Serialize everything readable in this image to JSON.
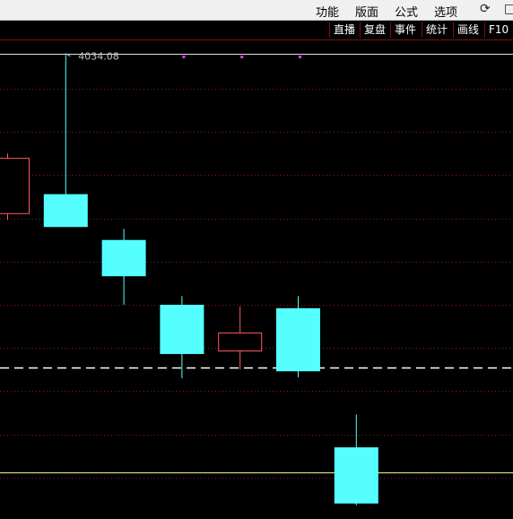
{
  "menu": {
    "items": [
      "功能",
      "版面",
      "公式",
      "选项"
    ],
    "refresh_icon": "refresh-icon",
    "restore_icon": "window-restore-icon"
  },
  "toolbar": {
    "buttons": [
      "直播",
      "复盘",
      "事件",
      "统计",
      "画线",
      "F10"
    ]
  },
  "chart_data": {
    "type": "candlestick",
    "high_label": "4034.08",
    "candles": [
      {
        "open": 4015.5,
        "close": 4022.0,
        "high": 4022.5,
        "low": 4014.8,
        "direction": "up"
      },
      {
        "open": 4017.8,
        "close": 4014.0,
        "high": 4034.08,
        "low": 4014.0,
        "direction": "down"
      },
      {
        "open": 4012.5,
        "close": 4008.3,
        "high": 4013.8,
        "low": 4005.0,
        "direction": "down"
      },
      {
        "open": 4005.0,
        "close": 3999.3,
        "high": 4006.0,
        "low": 3996.5,
        "direction": "down"
      },
      {
        "open": 3999.6,
        "close": 4001.8,
        "high": 4004.8,
        "low": 3997.5,
        "direction": "up"
      },
      {
        "open": 4004.6,
        "close": 3997.3,
        "high": 4006.0,
        "low": 3996.6,
        "direction": "down"
      },
      {
        "open": 3988.5,
        "close": 3982.0,
        "high": 3992.3,
        "low": 3981.8,
        "direction": "down"
      }
    ],
    "y_grid_values": [
      4030,
      4025,
      4020,
      4015,
      4010,
      4005,
      4000,
      3995,
      3990,
      3985,
      3980,
      3975
    ],
    "reference_lines": {
      "top_white": 4034.08,
      "dashed": 3997.7,
      "yellow": 3985.6
    },
    "marker_candle_indices": [
      3,
      4,
      5
    ],
    "colors": {
      "up": "#ff5a5a",
      "down": "#55ffff",
      "grid": "#8b1a1a",
      "dashed": "#ffffff",
      "yellow_line": "#e8ff80",
      "marker": "#ff33ff",
      "label": "#c8c8c8"
    }
  }
}
